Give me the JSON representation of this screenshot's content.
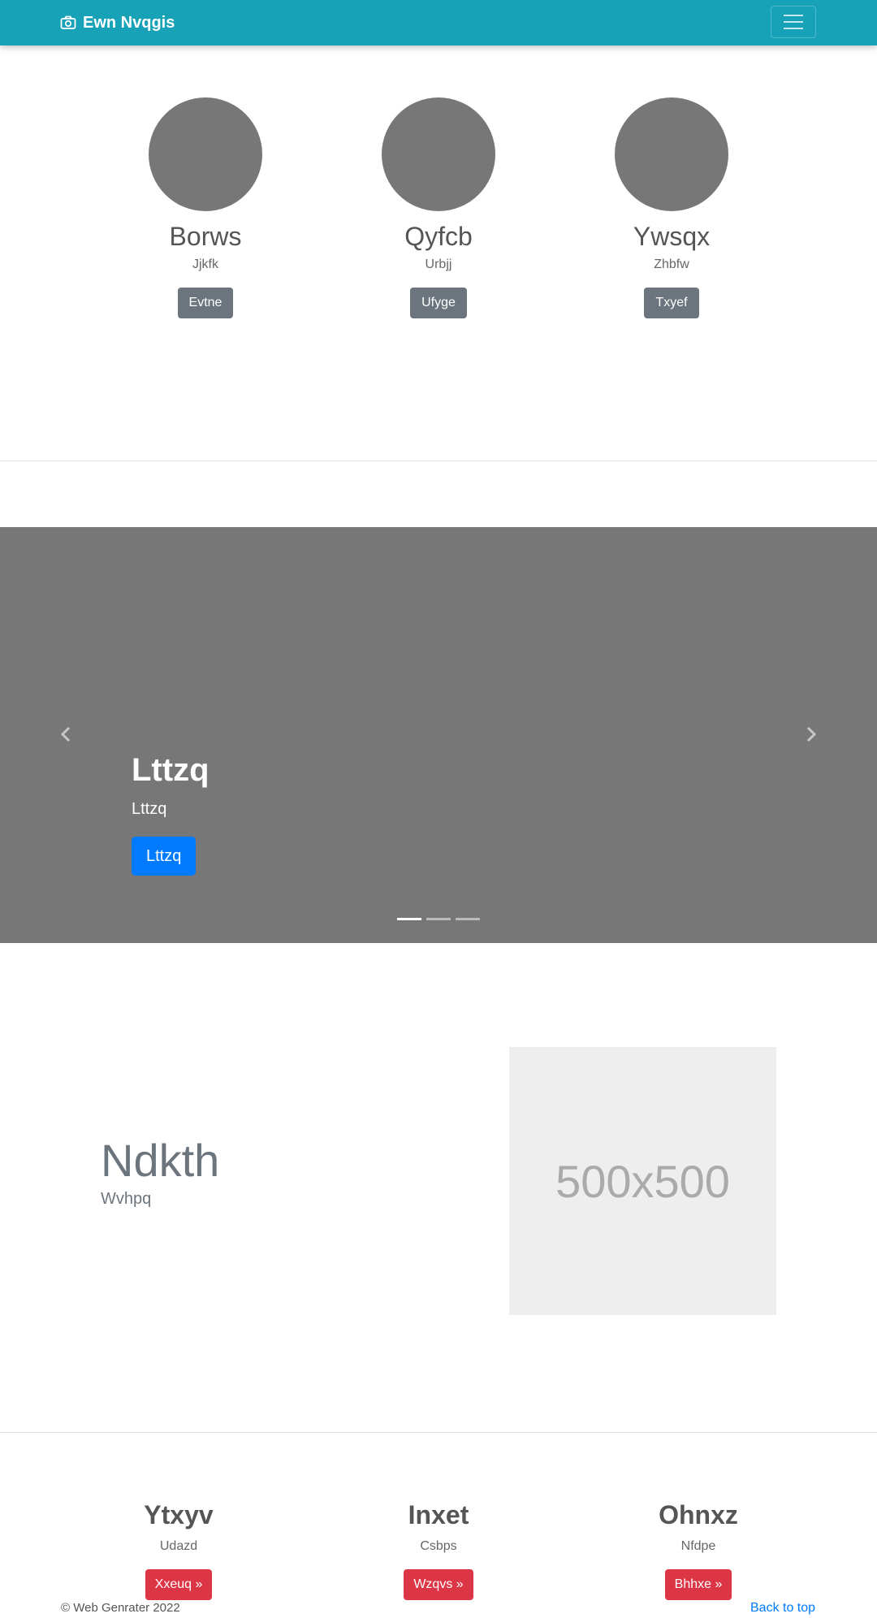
{
  "navbar": {
    "brand": "Ewn Nvqgis",
    "brand_icon": "camera-icon",
    "toggler_icon": "hamburger-icon",
    "background": "#17a2b8"
  },
  "profiles": [
    {
      "name": "Borws",
      "subtitle": "Jjkfk",
      "button": "Evtne"
    },
    {
      "name": "Qyfcb",
      "subtitle": "Urbjj",
      "button": "Ufyge"
    },
    {
      "name": "Ywsqx",
      "subtitle": "Zhbfw",
      "button": "Txyef"
    }
  ],
  "carousel": {
    "title": "Lttzq",
    "text": "Lttzq",
    "button": "Lttzq",
    "prev_icon": "chevron-left-icon",
    "next_icon": "chevron-right-icon",
    "slides": 3,
    "active_slide": 1
  },
  "feature": {
    "heading": "Ndkth",
    "lead": "Wvhpq",
    "placeholder": "500x500"
  },
  "columns": [
    {
      "heading": "Ytxyv",
      "text": "Udazd",
      "button": "Xxeuq »"
    },
    {
      "heading": "Inxet",
      "text": "Csbps",
      "button": "Wzqvs »"
    },
    {
      "heading": "Ohnxz",
      "text": "Nfdpe",
      "button": "Bhhxe »"
    }
  ],
  "footer": {
    "copyright": "© Web Genrater 2022",
    "back_to_top": "Back to top"
  }
}
